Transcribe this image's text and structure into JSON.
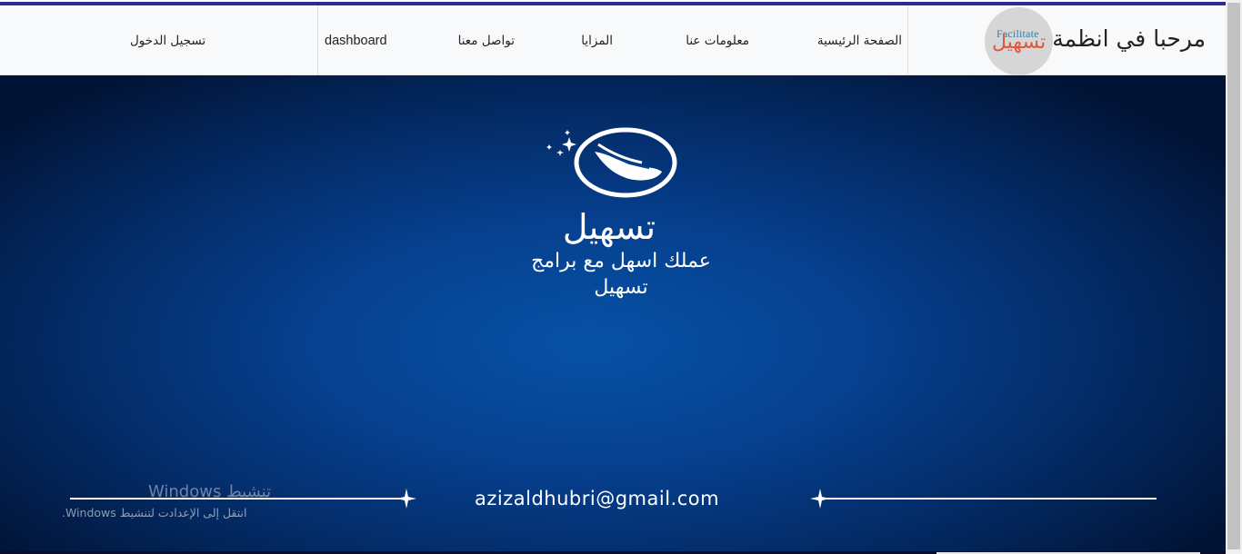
{
  "header": {
    "brand_title": "مرحبا في انظمة",
    "logo_text_en": "Facilitate",
    "logo_text_ar": "تسهيل",
    "nav": {
      "home": "الصفحة الرئيسية",
      "about": "معلومات عنا",
      "features": "المزايا",
      "contact": "تواصل معنا",
      "dashboard": "dashboard",
      "login": "تسجيل الدخول"
    }
  },
  "hero": {
    "title": "تسهيل",
    "subtitle_line1": "عملك اسهل مع برامج",
    "subtitle_line2": "تسهيل",
    "email": "azizaldhubri@gmail.com"
  },
  "windows_overlay": {
    "title": "تنشيط Windows",
    "subtitle": "انتقل إلى الإعدادت لتنشيط Windows."
  },
  "colors": {
    "accent": "#2b2a98",
    "hero_center": "#0752a6",
    "hero_edge": "#011436",
    "logo_text_en": "#2a7fb8",
    "logo_text_ar": "#e0573c"
  }
}
